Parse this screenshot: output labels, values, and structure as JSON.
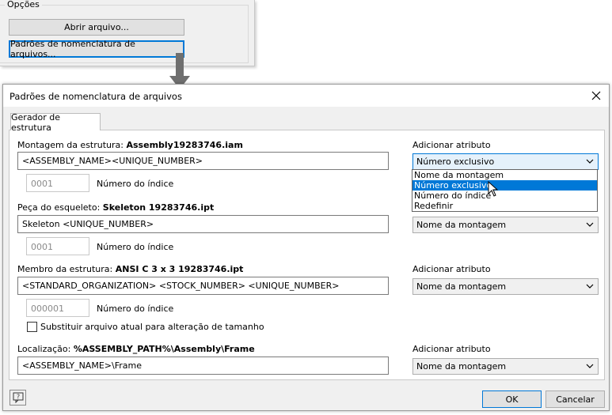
{
  "options": {
    "legend": "Opções",
    "open_button": "Abrir arquivo...",
    "naming_button": "Padrões de nomenclatura de arquivos..."
  },
  "dialog": {
    "title": "Padrões de nomenclatura de arquivos",
    "tab": "Gerador de estrutura",
    "assembly": {
      "label": "Montagem da estrutura:",
      "file": "Assembly19283746.iam",
      "pattern": "<ASSEMBLY_NAME><UNIQUE_NUMBER>",
      "index_value": "0001",
      "index_label": "Número do índice",
      "attr_label": "Adicionar atributo",
      "attr_value": "Número exclusivo"
    },
    "dropdown_options": [
      "Nome da montagem",
      "Número exclusivo",
      "Número do índice",
      "Redefinir"
    ],
    "dropdown_selected": "Número exclusivo",
    "skeleton": {
      "label": "Peça do esqueleto:",
      "file": "Skeleton 19283746.ipt",
      "pattern": "Skeleton <UNIQUE_NUMBER>",
      "index_value": "0001",
      "index_label": "Número do índice",
      "attr_value": "Nome da montagem"
    },
    "member": {
      "label": "Membro da estrutura:",
      "file": "ANSI C 3 x 3 19283746.ipt",
      "pattern": "<STANDARD_ORGANIZATION> <STOCK_NUMBER> <UNIQUE_NUMBER>",
      "index_value": "000001",
      "index_label": "Número do índice",
      "attr_label": "Adicionar atributo",
      "attr_value": "Nome da montagem"
    },
    "replace_checkbox": "Substituir arquivo atual para alteração de tamanho",
    "replace_checked": false,
    "location": {
      "label": "Localização:",
      "path": "%ASSEMBLY_PATH%\\Assembly\\Frame",
      "pattern": "<ASSEMBLY_NAME>\\Frame",
      "attr_label": "Adicionar atributo",
      "attr_value": "Nome da montagem"
    },
    "ok_button": "OK",
    "cancel_button": "Cancelar",
    "help_icon": "help-icon",
    "close_icon": "close-icon"
  },
  "colors": {
    "accent": "#0078d7",
    "dialog_bg": "#f0f0f0",
    "panel_bg": "#ffffff",
    "arrow": "#6f6f6f"
  }
}
